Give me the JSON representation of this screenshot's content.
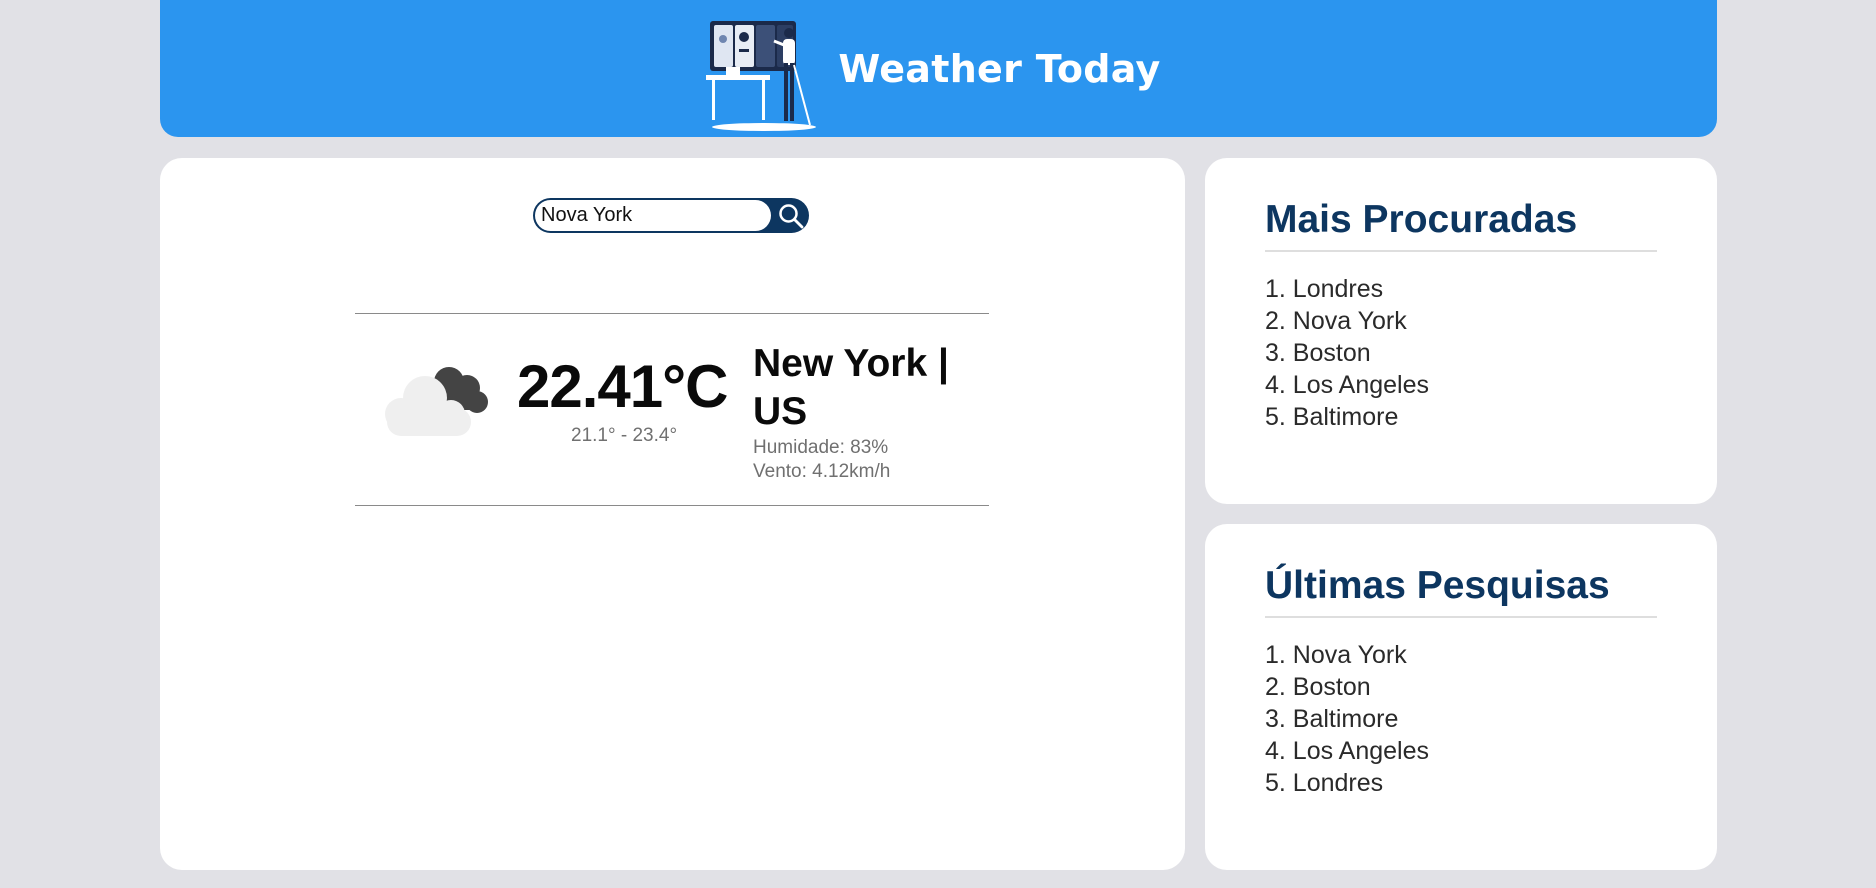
{
  "header": {
    "title": "Weather Today"
  },
  "search": {
    "value": "Nova York",
    "icon": "search-icon"
  },
  "weather": {
    "icon": "cloudy-icon",
    "temperature": "22.41°C",
    "range": "21.1° - 23.4°",
    "city": "New York | US",
    "humidity": "Humidade: 83%",
    "wind": "Vento: 4.12km/h"
  },
  "most_searched": {
    "title": "Mais Procuradas",
    "items": [
      "1. Londres",
      "2. Nova York",
      "3. Boston",
      "4. Los Angeles",
      "5. Baltimore"
    ]
  },
  "recent_searches": {
    "title": "Últimas Pesquisas",
    "items": [
      "1. Nova York",
      "2. Boston",
      "3. Baltimore",
      "4. Los Angeles",
      "5. Londres"
    ]
  },
  "colors": {
    "header": "#2b95ef",
    "accent": "#0d3660",
    "background": "#e1e1e6"
  }
}
